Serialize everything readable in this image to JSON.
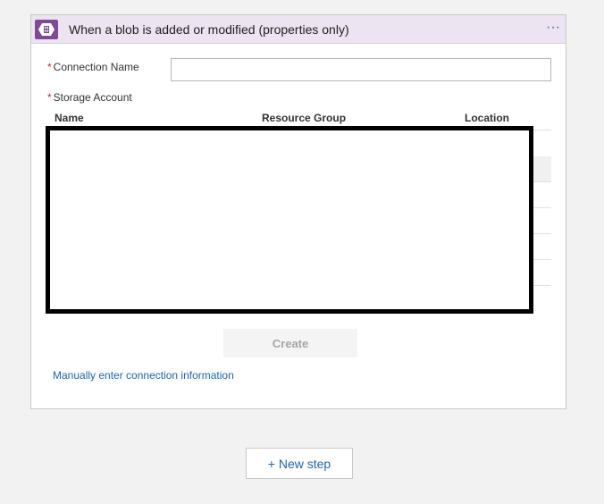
{
  "trigger": {
    "title": "When a blob is added or modified (properties only)",
    "more_label": "···",
    "icon": "storage-blob-icon",
    "accent_color": "#804998"
  },
  "form": {
    "connection_name_label": "Connection Name",
    "connection_name_value": "",
    "required_marker": "*",
    "storage_account_label": "Storage Account"
  },
  "storage_table": {
    "columns": [
      "Name",
      "Resource Group",
      "Location"
    ]
  },
  "actions": {
    "create_label": "Create",
    "manual_link_label": "Manually enter connection information",
    "new_step_label": "+ New step"
  }
}
